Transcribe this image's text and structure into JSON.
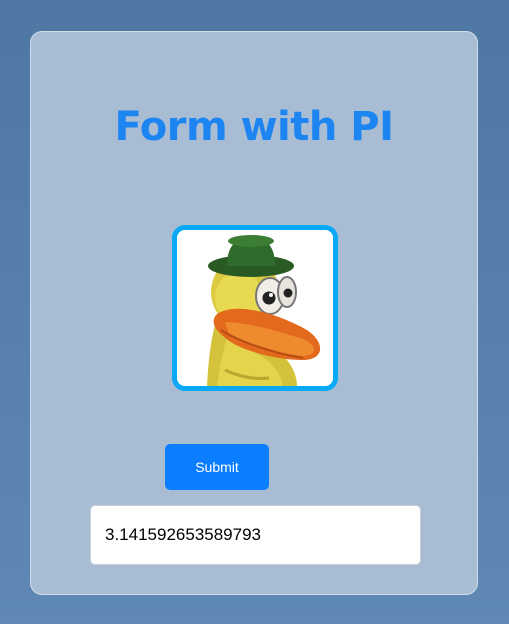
{
  "form": {
    "title": "Form with PI",
    "image": {
      "icon": "duck-mascot-image"
    },
    "submit_label": "Submit",
    "result_value": "3.141592653589793"
  },
  "colors": {
    "page_background": "#5a82ae",
    "card_background": "#a8bdd4",
    "title": "#1d85f2",
    "image_border": "#0aa9f7",
    "button": "#0b7dff"
  }
}
